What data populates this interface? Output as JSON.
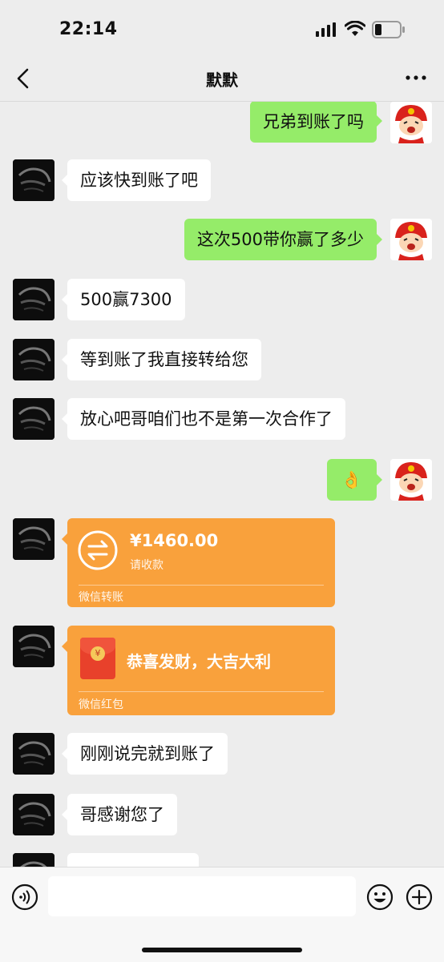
{
  "status_bar": {
    "time": "22:14"
  },
  "header": {
    "title": "默默"
  },
  "messages": [
    {
      "side": "out",
      "text": "兄弟到账了吗"
    },
    {
      "side": "in",
      "text": "应该快到账了吧"
    },
    {
      "side": "out",
      "text": "这次500带你赢了多少"
    },
    {
      "side": "in",
      "text": "500赢7300"
    },
    {
      "side": "in",
      "text": "等到账了我直接转给您"
    },
    {
      "side": "in",
      "text": "放心吧哥咱们也不是第一次合作了"
    },
    {
      "side": "out",
      "text": "👌"
    },
    {
      "side": "in",
      "text": "刚刚说完就到账了"
    },
    {
      "side": "in",
      "text": "哥感谢您了"
    }
  ],
  "transfer": {
    "amount": "¥1460.00",
    "subtitle": "请收款",
    "footer": "微信转账"
  },
  "red_packet": {
    "greeting": "恭喜发财，大吉大利",
    "footer": "微信红包",
    "symbol": "¥"
  },
  "icons": {
    "back": "chevron-left-icon",
    "more": "more-dots-icon",
    "voice": "voice-icon",
    "emoji": "emoji-icon",
    "plus": "plus-icon"
  },
  "colors": {
    "outgoing_bubble": "#95ec69",
    "incoming_bubble": "#ffffff",
    "money_card": "#f9a13c",
    "background": "#ededed"
  }
}
